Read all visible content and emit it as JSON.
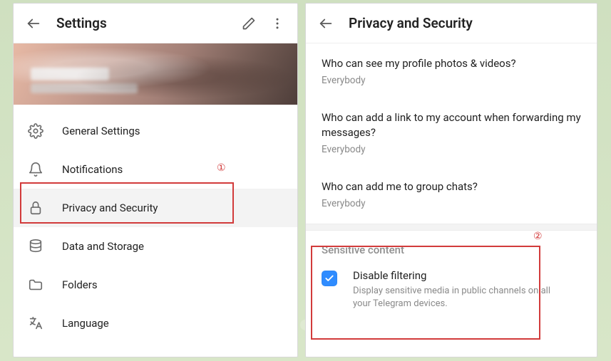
{
  "left": {
    "title": "Settings",
    "items": [
      {
        "icon": "gear-icon",
        "label": "General Settings",
        "active": false
      },
      {
        "icon": "bell-icon",
        "label": "Notifications",
        "active": false
      },
      {
        "icon": "lock-icon",
        "label": "Privacy and Security",
        "active": true
      },
      {
        "icon": "database-icon",
        "label": "Data and Storage",
        "active": false
      },
      {
        "icon": "folder-icon",
        "label": "Folders",
        "active": false
      },
      {
        "icon": "language-icon",
        "label": "Language",
        "active": false
      }
    ]
  },
  "right": {
    "title": "Privacy and Security",
    "privacy_items": [
      {
        "question": "Who can see my profile photos & videos?",
        "answer": "Everybody"
      },
      {
        "question": "Who can add a link to my account when forwarding my messages?",
        "answer": "Everybody"
      },
      {
        "question": "Who can add me to group chats?",
        "answer": "Everybody"
      }
    ],
    "sensitive": {
      "section_title": "Sensitive content",
      "checkbox_checked": true,
      "checkbox_title": "Disable filtering",
      "checkbox_desc": "Display sensitive media in public channels on all your Telegram devices."
    }
  },
  "annotations": {
    "num1": "①",
    "num2": "②"
  }
}
